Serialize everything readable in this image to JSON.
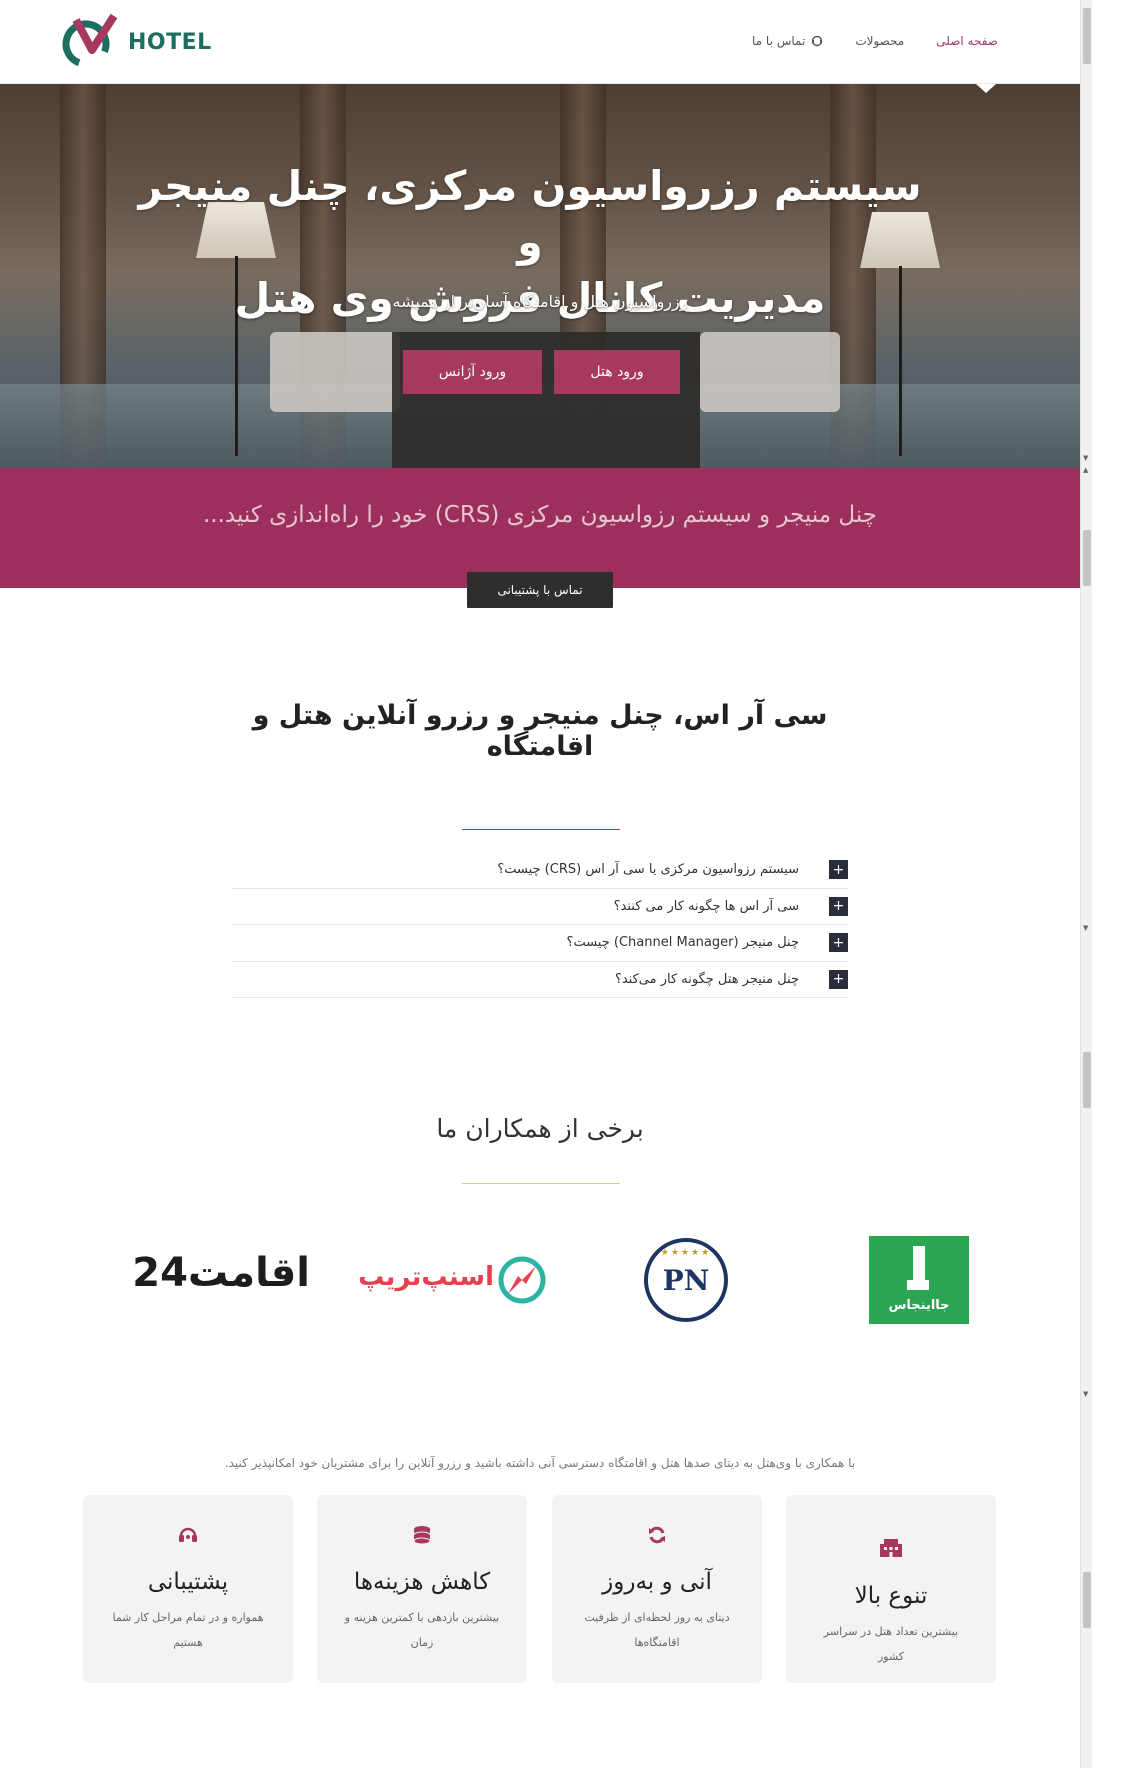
{
  "header": {
    "logo_text": "HOTEL",
    "nav": {
      "home": "صفحه اصلی",
      "products": "محصولات",
      "contact": "تماس با ما"
    }
  },
  "hero": {
    "title_line1": "سیستم رزرواسیون مرکزی، چنل منیجر و",
    "title_line2": "مدیریت کانال فروش وی هتل",
    "subtitle": "رزرواسیون هتل و اقامتگاه آسان‌تر از همیشه",
    "hotel_login": "ورود هتل",
    "agency_login": "ورود آژانس"
  },
  "banner": {
    "text": "چنل منیجر و سیستم رزواسیون مرکزی (CRS) خود را راه‌اندازی کنید...",
    "support_button": "تماس با پشتیبانی"
  },
  "section": {
    "title": "سی آر اس، چنل منیجر و رزرو آنلاین هتل و اقامتگاه"
  },
  "faq": [
    {
      "label": "سیستم رزواسیون مرکزی یا سی آر اس (CRS) چیست؟"
    },
    {
      "label": "سی آر اس ها چگونه کار می کنند؟"
    },
    {
      "label": "چنل منیجر (Channel Manager) چیست؟"
    },
    {
      "label": "چنل منیجر هتل چگونه کار می‌کند؟"
    }
  ],
  "partners": {
    "title": "برخی از همکاران ما",
    "items": [
      {
        "name": "جااینجاس"
      },
      {
        "name": "PN"
      },
      {
        "name": "اسنپ‌تریپ"
      },
      {
        "name": "اقامت24"
      }
    ]
  },
  "features": {
    "intro": "با همکاری با وی‌هتل به دیتای صدها هتل و اقامتگاه دسترسی آنی داشته باشید و رزرو آنلاین را برای مشتریان خود امکانپذیر کنید.",
    "cards": [
      {
        "icon": "building-icon",
        "title": "تنوع بالا",
        "desc": "بیشترین تعداد هتل در سراسر کشور"
      },
      {
        "icon": "refresh-icon",
        "title": "آنی و به‌روز",
        "desc": "دیتای به روز لحظه‌ای از ظرفیت اقامتگاه‌ها"
      },
      {
        "icon": "coins-icon",
        "title": "کاهش هزینه‌ها",
        "desc": "بیشترین بازدهی با کمترین هزینه و زمان"
      },
      {
        "icon": "headset-icon",
        "title": "پشتیبانی",
        "desc": "همواره و در تمام مراحل کار شما هستیم"
      }
    ]
  },
  "colors": {
    "accent": "#a7385f",
    "banner": "#9c2f5b",
    "dark_button": "#2e2e2e",
    "logo_green": "#1e6e5f"
  }
}
